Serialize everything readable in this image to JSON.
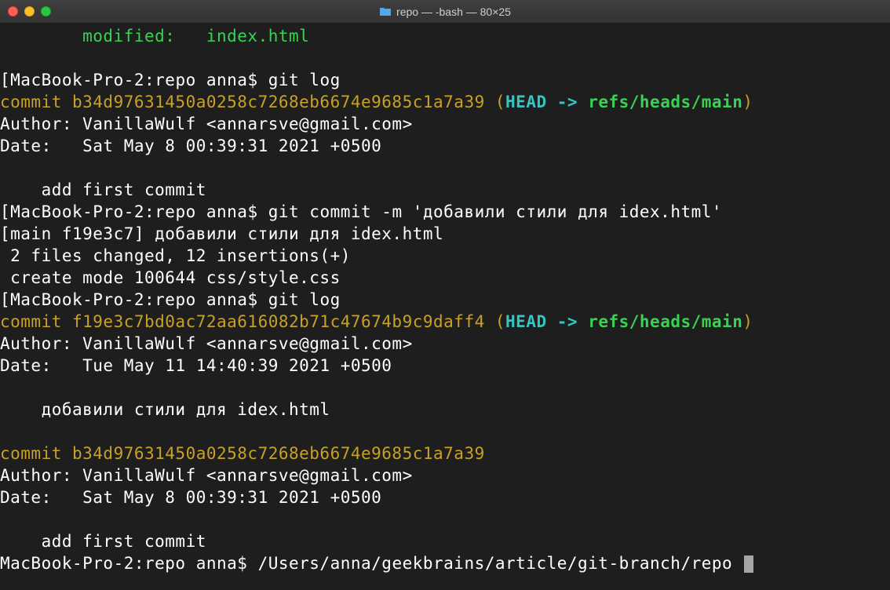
{
  "window": {
    "title": "repo — -bash — 80×25"
  },
  "terminal": {
    "modified_line": "        modified:   index.html",
    "blank": "",
    "prompt1_bracket_open": "[",
    "prompt1_host": "MacBook-Pro-2:repo anna$ ",
    "prompt1_cmd": "git log",
    "commit1_pre": "commit b34d97631450a0258c7268eb6674e9685c1a7a39",
    "commit1_open": " (",
    "commit1_head": "HEAD -> ",
    "commit1_ref": "refs/heads/main",
    "commit1_close": ")",
    "author1": "Author: VanillaWulf <annarsve@gmail.com>",
    "date1": "Date:   Sat May 8 00:39:31 2021 +0500",
    "msg1": "    add first commit",
    "prompt2_bracket_open": "[",
    "prompt2_host": "MacBook-Pro-2:repo anna$ ",
    "prompt2_cmd": "git commit -m 'добавили стили для idex.html'",
    "result1": "[main f19e3c7] добавили стили для idex.html",
    "result2": " 2 files changed, 12 insertions(+)",
    "result3": " create mode 100644 css/style.css",
    "prompt3_bracket_open": "[",
    "prompt3_host": "MacBook-Pro-2:repo anna$ ",
    "prompt3_cmd": "git log",
    "commit2_pre": "commit f19e3c7bd0ac72aa616082b71c47674b9c9daff4",
    "commit2_open": " (",
    "commit2_head": "HEAD -> ",
    "commit2_ref": "refs/heads/main",
    "commit2_close": ")",
    "author2": "Author: VanillaWulf <annarsve@gmail.com>",
    "date2": "Date:   Tue May 11 14:40:39 2021 +0500",
    "msg2": "    добавили стили для idex.html",
    "commit3_pre": "commit b34d97631450a0258c7268eb6674e9685c1a7a39",
    "author3": "Author: VanillaWulf <annarsve@gmail.com>",
    "date3": "Date:   Sat May 8 00:39:31 2021 +0500",
    "msg3": "    add first commit",
    "prompt4_host": "MacBook-Pro-2:repo anna$ ",
    "prompt4_cmd": "/Users/anna/geekbrains/article/git-branch/repo "
  }
}
